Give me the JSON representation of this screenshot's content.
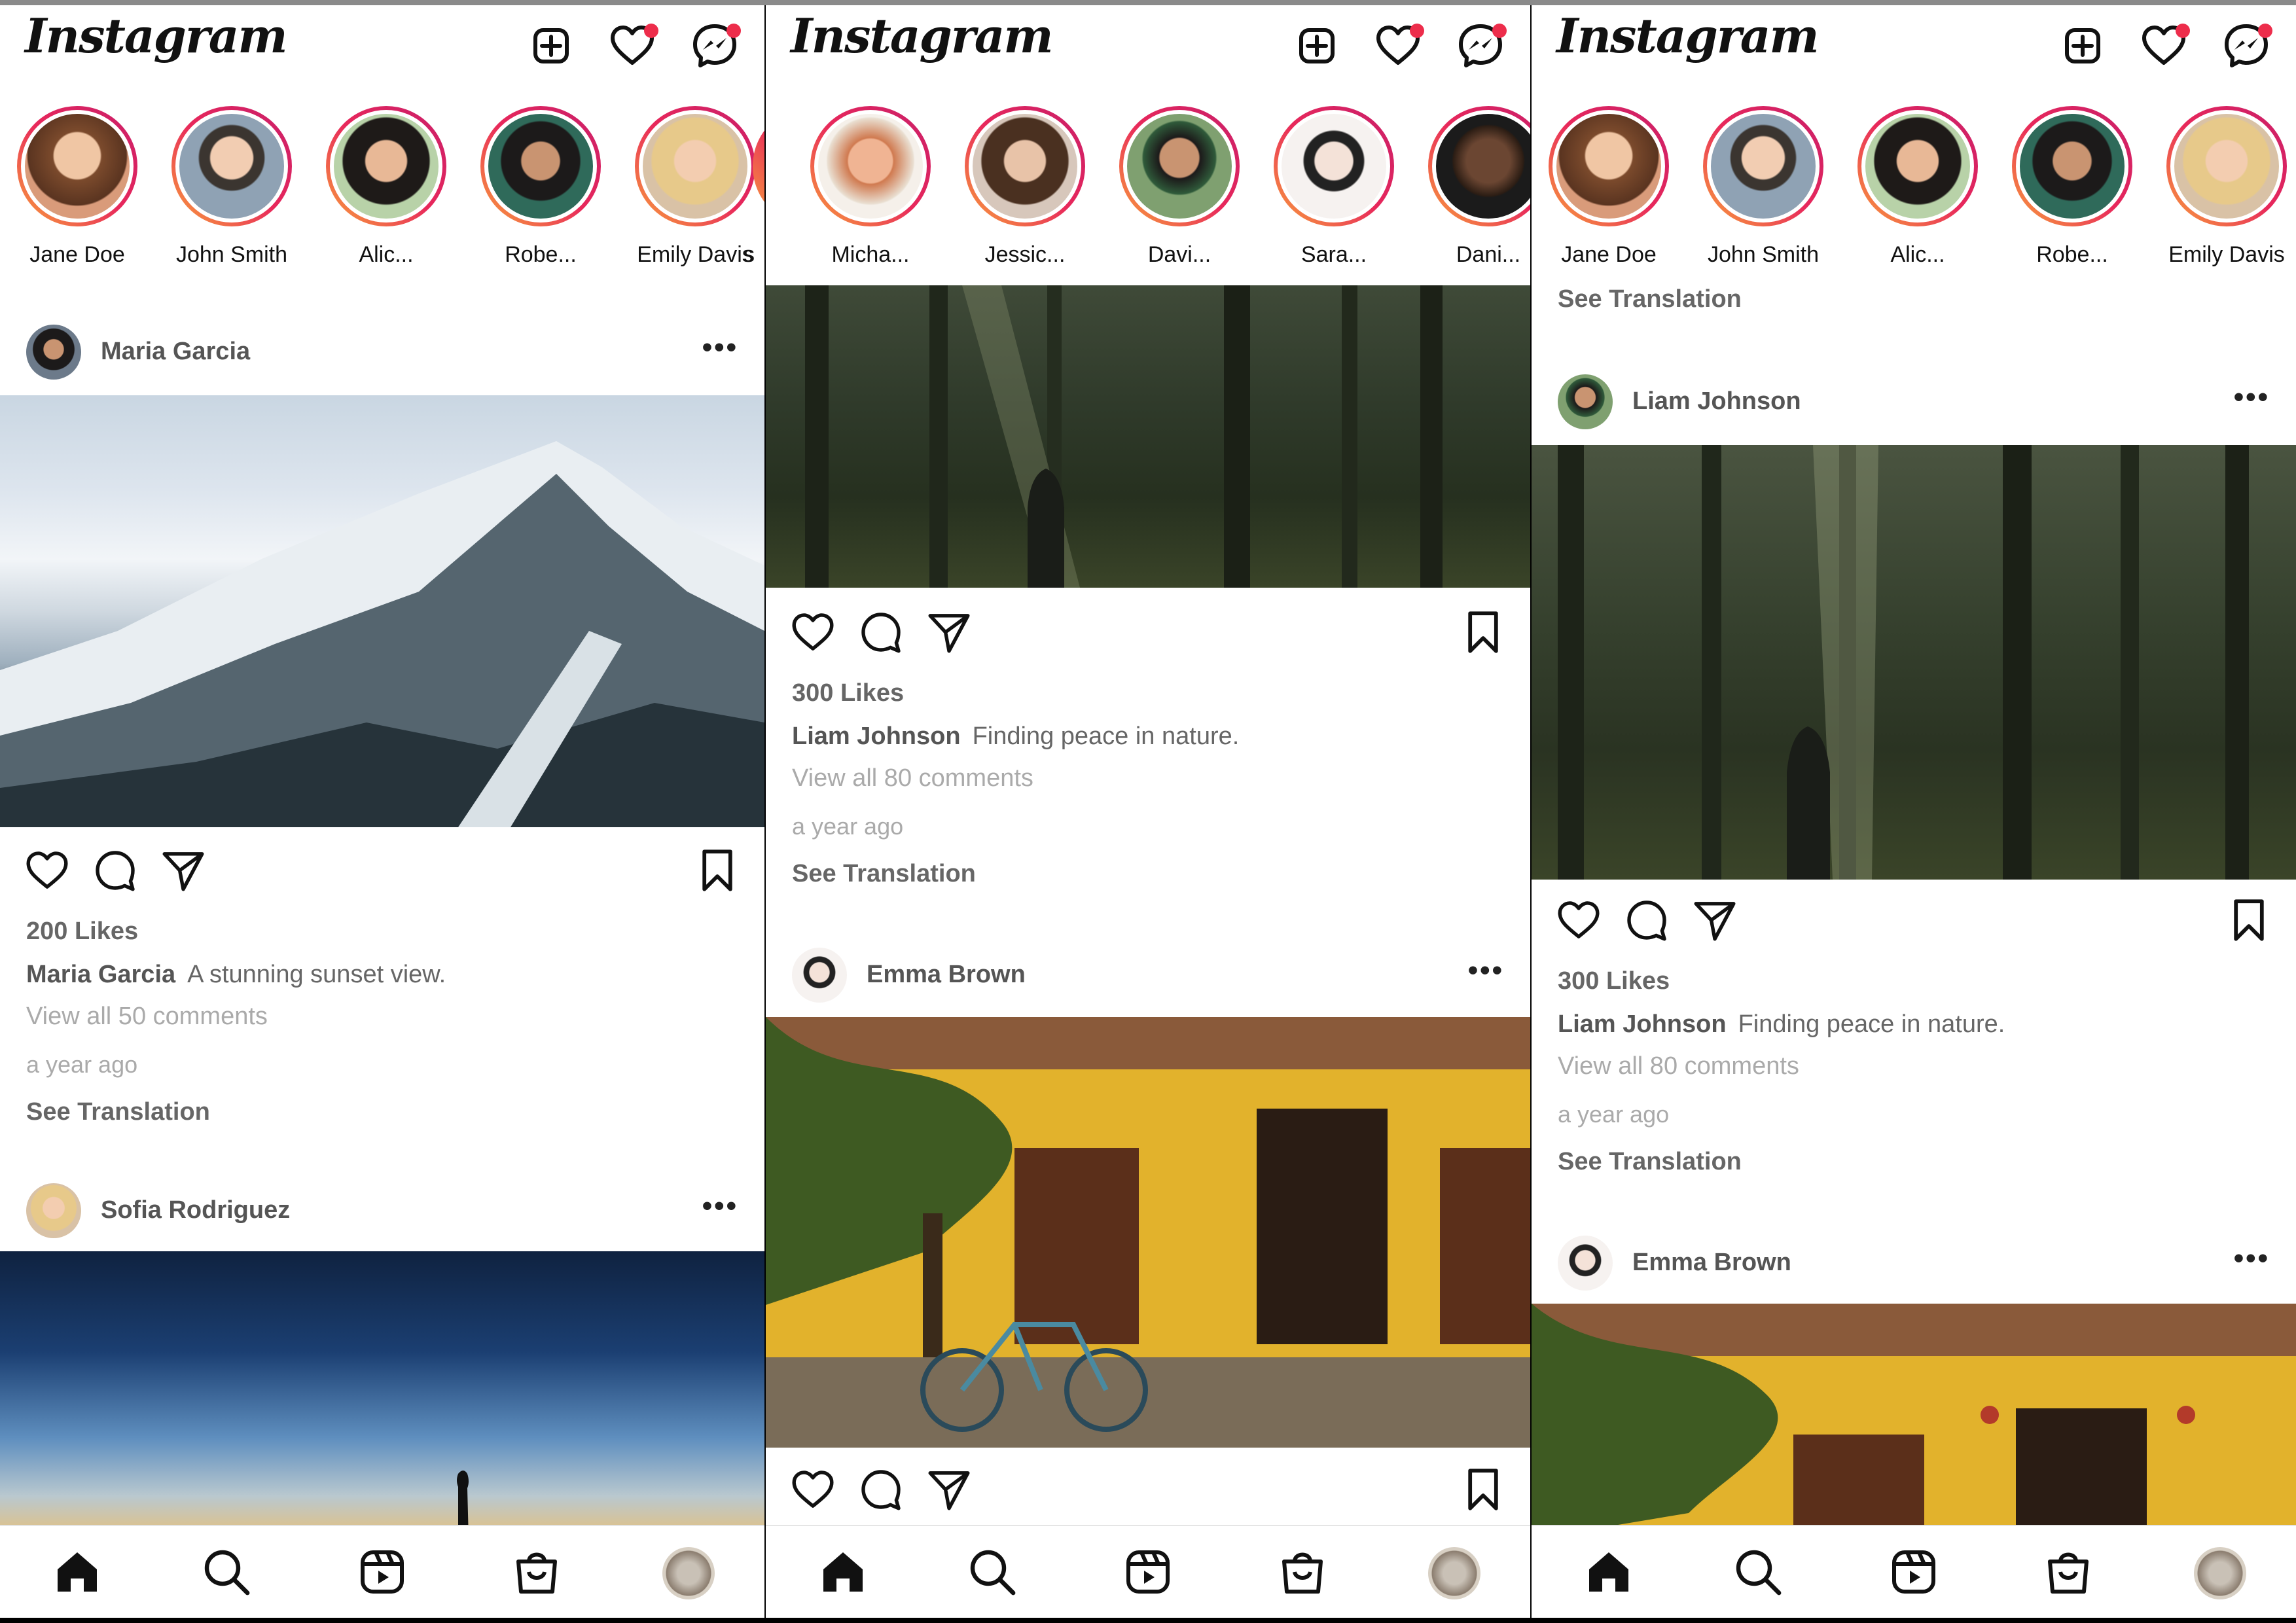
{
  "app": {
    "logo": "Instagram"
  },
  "colors": {
    "accent": "#ed2d4b",
    "text": "#111111",
    "muted": "#aaaaaa"
  },
  "header_icons": [
    "plus-square-icon",
    "heart-icon",
    "messenger-icon"
  ],
  "nav_icons": [
    "home-icon",
    "search-icon",
    "reels-icon",
    "shop-icon",
    "profile-avatar"
  ],
  "screens": [
    {
      "stories": [
        "Jane Doe",
        "John Smith",
        "Alic...",
        "Robe...",
        "Emily Davis",
        "s"
      ],
      "posts": [
        {
          "user": "Maria Garcia",
          "likes": "200 Likes",
          "caption_user": "Maria Garcia",
          "caption_text": "A stunning sunset view.",
          "comments": "View all 50 comments",
          "ago": "a year ago",
          "see_translation": "See Translation"
        },
        {
          "user": "Sofia Rodriguez"
        }
      ]
    },
    {
      "stories": [
        "Micha...",
        "Jessic...",
        "Davi...",
        "Sara...",
        "Dani..."
      ],
      "posts": [
        {
          "likes": "300 Likes",
          "caption_user": "Liam Johnson",
          "caption_text": "Finding peace in nature.",
          "comments": "View all 80 comments",
          "ago": "a year ago",
          "see_translation": "See Translation"
        },
        {
          "user": "Emma Brown"
        }
      ]
    },
    {
      "stories": [
        "Jane Doe",
        "John Smith",
        "Alic...",
        "Robe...",
        "Emily Davis"
      ],
      "top_see_translation": "See Translation",
      "posts": [
        {
          "user": "Liam Johnson",
          "likes": "300 Likes",
          "caption_user": "Liam Johnson",
          "caption_text": "Finding peace in nature.",
          "comments": "View all 80 comments",
          "ago": "a year ago",
          "see_translation": "See Translation"
        },
        {
          "user": "Emma Brown"
        }
      ]
    }
  ]
}
